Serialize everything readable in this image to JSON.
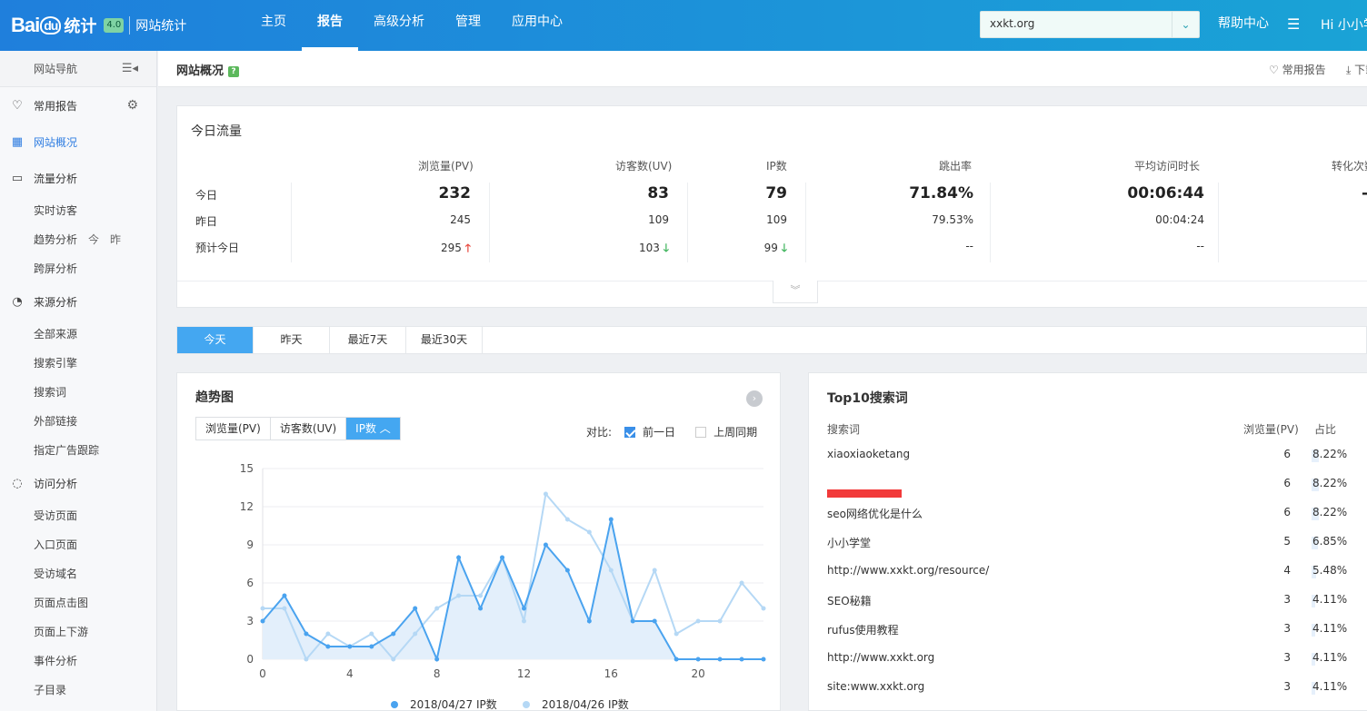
{
  "header": {
    "logo_brand": "Bai",
    "logo_du": "du",
    "logo_product": "统计",
    "logo_badge": "4.0",
    "logo_sub": "网站统计",
    "nav": [
      "主页",
      "报告",
      "高级分析",
      "管理",
      "应用中心"
    ],
    "active_nav": "报告",
    "site": "xxkt.org",
    "help": "帮助中心",
    "user": "Hi  小小学"
  },
  "sidebar": {
    "head": "网站导航",
    "fav_reports": "常用报告",
    "overview": "网站概况",
    "traffic": {
      "label": "流量分析",
      "items": [
        "实时访客",
        "趋势分析",
        "跨屏分析"
      ],
      "trend_extra": [
        "今",
        "昨"
      ]
    },
    "source": {
      "label": "来源分析",
      "items": [
        "全部来源",
        "搜索引擎",
        "搜索词",
        "外部链接",
        "指定广告跟踪"
      ]
    },
    "visit": {
      "label": "访问分析",
      "items": [
        "受访页面",
        "入口页面",
        "受访域名",
        "页面点击图",
        "页面上下游",
        "事件分析",
        "子目录"
      ]
    }
  },
  "content_head": {
    "title": "网站概况",
    "help_mark": "?",
    "fav": "常用报告",
    "download": "下载"
  },
  "today": {
    "title": "今日流量",
    "columns": [
      "浏览量(PV)",
      "访客数(UV)",
      "IP数",
      "跳出率",
      "平均访问时长",
      "转化次数"
    ],
    "rows": [
      {
        "label": "今日",
        "values": [
          "232",
          "83",
          "79",
          "71.84%",
          "00:06:44",
          "-"
        ]
      },
      {
        "label": "昨日",
        "values": [
          "245",
          "109",
          "109",
          "79.53%",
          "00:04:24",
          ""
        ]
      },
      {
        "label": "预计今日",
        "values": [
          "295",
          "103",
          "99",
          "--",
          "--",
          ""
        ],
        "trend": [
          "up",
          "down",
          "down",
          "",
          "",
          ""
        ]
      }
    ]
  },
  "range_tabs": [
    "今天",
    "昨天",
    "最近7天",
    "最近30天"
  ],
  "trend": {
    "title": "趋势图",
    "metric_tabs": [
      "浏览量(PV)",
      "访客数(UV)",
      "IP数"
    ],
    "compare_label": "对比:",
    "compare_options": [
      "前一日",
      "上周同期"
    ],
    "colors": {
      "today": "#4aa3ef",
      "yesterday": "#b5d8f5",
      "fill": "#e3effb"
    }
  },
  "chart_data": {
    "type": "area",
    "x": [
      0,
      1,
      2,
      3,
      4,
      5,
      6,
      7,
      8,
      9,
      10,
      11,
      12,
      13,
      14,
      15,
      16,
      17,
      18,
      19,
      20,
      21,
      22,
      23
    ],
    "xticks": [
      0,
      4,
      8,
      12,
      16,
      20
    ],
    "yticks": [
      0,
      3,
      6,
      9,
      12,
      15
    ],
    "ylim": [
      0,
      15
    ],
    "xlim": [
      0,
      23
    ],
    "grid": true,
    "legend": "bottom",
    "series": [
      {
        "name": "2018/04/27 IP数",
        "values": [
          3,
          5,
          2,
          1,
          1,
          1,
          2,
          4,
          0,
          8,
          4,
          8,
          4,
          9,
          7,
          3,
          11,
          3,
          3,
          0,
          0,
          0,
          0,
          0
        ]
      },
      {
        "name": "2018/04/26 IP数",
        "values": [
          4,
          4,
          0,
          2,
          1,
          2,
          0,
          2,
          4,
          5,
          5,
          8,
          3,
          13,
          11,
          10,
          7,
          3,
          7,
          2,
          3,
          3,
          6,
          4
        ]
      }
    ]
  },
  "top10": {
    "title": "Top10搜索词",
    "columns": [
      "搜索词",
      "浏览量(PV)",
      "占比"
    ],
    "rows": [
      {
        "kw": "xiaoxiaoketang",
        "pv": "6",
        "pct": "8.22%",
        "frac": 0.0822
      },
      {
        "kw": "",
        "pv": "6",
        "pct": "8.22%",
        "frac": 0.0822,
        "redacted": true
      },
      {
        "kw": "seo网络优化是什么",
        "pv": "6",
        "pct": "8.22%",
        "frac": 0.0822
      },
      {
        "kw": "小小学堂",
        "pv": "5",
        "pct": "6.85%",
        "frac": 0.0685
      },
      {
        "kw": "http://www.xxkt.org/resource/",
        "pv": "4",
        "pct": "5.48%",
        "frac": 0.0548
      },
      {
        "kw": "SEO秘籍",
        "pv": "3",
        "pct": "4.11%",
        "frac": 0.0411
      },
      {
        "kw": "rufus使用教程",
        "pv": "3",
        "pct": "4.11%",
        "frac": 0.0411
      },
      {
        "kw": "http://www.xxkt.org",
        "pv": "3",
        "pct": "4.11%",
        "frac": 0.0411
      },
      {
        "kw": "site:www.xxkt.org",
        "pv": "3",
        "pct": "4.11%",
        "frac": 0.0411
      }
    ]
  }
}
